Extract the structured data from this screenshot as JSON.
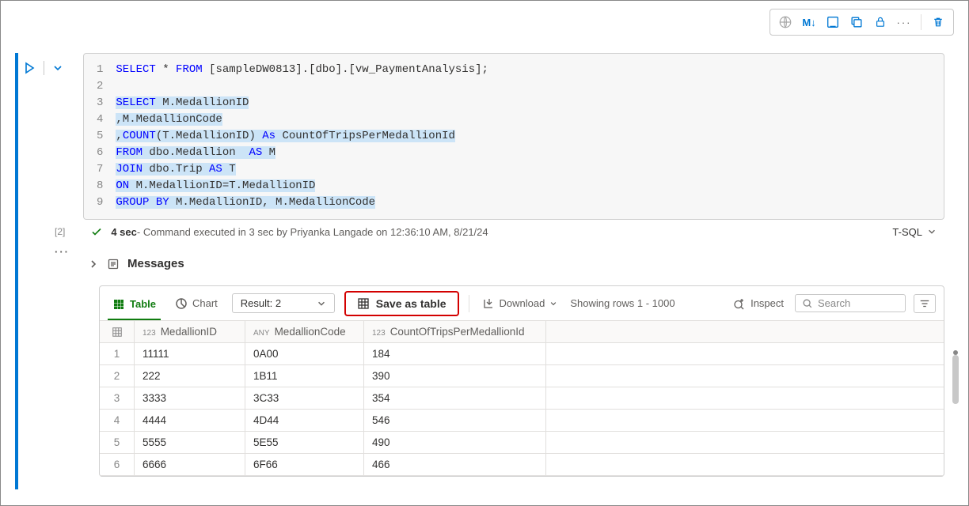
{
  "toolbar": {
    "markdown_label": "M↓"
  },
  "code": {
    "lines": [
      {
        "n": "1",
        "tokens": [
          {
            "t": "SELECT",
            "c": "kw"
          },
          {
            "t": " * ",
            "c": ""
          },
          {
            "t": "FROM",
            "c": "kw"
          },
          {
            "t": " [sampleDW0813].[dbo].[vw_PaymentAnalysis];",
            "c": ""
          }
        ]
      },
      {
        "n": "2",
        "tokens": []
      },
      {
        "n": "3",
        "hl": true,
        "tokens": [
          {
            "t": "SELECT",
            "c": "kw"
          },
          {
            "t": " M.MedallionID",
            "c": ""
          }
        ]
      },
      {
        "n": "4",
        "hl": true,
        "tokens": [
          {
            "t": ",M.MedallionCode",
            "c": ""
          }
        ]
      },
      {
        "n": "5",
        "hl": true,
        "tokens": [
          {
            "t": ",",
            "c": ""
          },
          {
            "t": "COUNT",
            "c": "kw"
          },
          {
            "t": "(T.MedallionID) ",
            "c": ""
          },
          {
            "t": "As",
            "c": "kw"
          },
          {
            "t": " CountOfTripsPerMedallionId",
            "c": ""
          }
        ]
      },
      {
        "n": "6",
        "hl": true,
        "tokens": [
          {
            "t": "FROM",
            "c": "kw"
          },
          {
            "t": " dbo.Medallion  ",
            "c": ""
          },
          {
            "t": "AS",
            "c": "kw"
          },
          {
            "t": " M",
            "c": ""
          }
        ]
      },
      {
        "n": "7",
        "hl": true,
        "tokens": [
          {
            "t": "JOIN",
            "c": "kw"
          },
          {
            "t": " dbo.Trip ",
            "c": ""
          },
          {
            "t": "AS",
            "c": "kw"
          },
          {
            "t": " T",
            "c": ""
          }
        ]
      },
      {
        "n": "8",
        "hl": true,
        "tokens": [
          {
            "t": "ON",
            "c": "kw"
          },
          {
            "t": " M.MedallionID=T.MedallionID",
            "c": ""
          }
        ]
      },
      {
        "n": "9",
        "hl": true,
        "tokens": [
          {
            "t": "GROUP BY",
            "c": "kw"
          },
          {
            "t": " M.MedallionID, M.MedallionCode",
            "c": ""
          }
        ]
      }
    ]
  },
  "status": {
    "index": "[2]",
    "time": "4 sec",
    "message": " - Command executed in 3 sec by Priyanka Langade on 12:36:10 AM, 8/21/24",
    "language": "T-SQL"
  },
  "messages": {
    "label": "Messages"
  },
  "results": {
    "tabs": {
      "table": "Table",
      "chart": "Chart"
    },
    "result_select": "Result: 2",
    "save_as_table": "Save as table",
    "download": "Download",
    "showing": "Showing rows 1 - 1000",
    "inspect": "Inspect",
    "search_placeholder": "Search"
  },
  "grid": {
    "columns": [
      {
        "type": "123",
        "name": "MedallionID"
      },
      {
        "type": "ANY",
        "name": "MedallionCode"
      },
      {
        "type": "123",
        "name": "CountOfTripsPerMedallionId"
      }
    ],
    "rows": [
      {
        "n": "1",
        "c": [
          "11111",
          "0A00",
          "184"
        ]
      },
      {
        "n": "2",
        "c": [
          "222",
          "1B11",
          "390"
        ]
      },
      {
        "n": "3",
        "c": [
          "3333",
          "3C33",
          "354"
        ]
      },
      {
        "n": "4",
        "c": [
          "4444",
          "4D44",
          "546"
        ]
      },
      {
        "n": "5",
        "c": [
          "5555",
          "5E55",
          "490"
        ]
      },
      {
        "n": "6",
        "c": [
          "6666",
          "6F66",
          "466"
        ]
      }
    ]
  }
}
